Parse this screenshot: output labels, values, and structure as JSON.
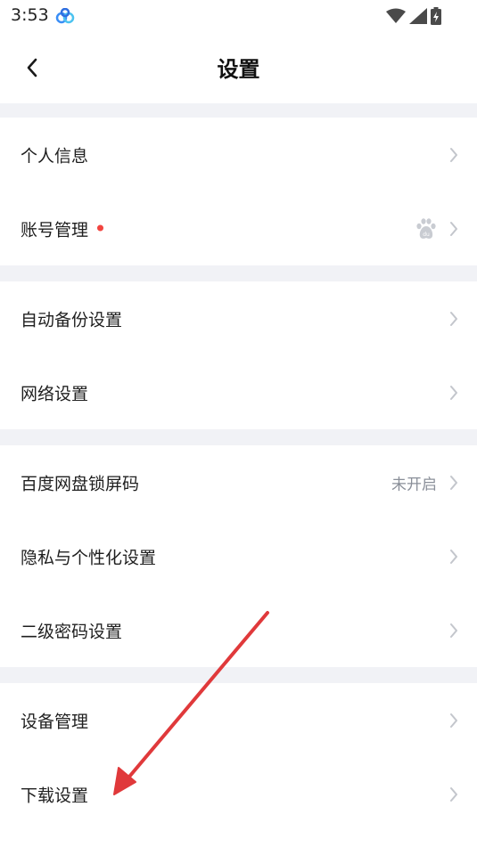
{
  "status_bar": {
    "time": "3:53",
    "app_icon": "baidu-netdisk-icon",
    "icons": [
      "wifi-icon",
      "signal-icon",
      "battery-charging-icon"
    ]
  },
  "header": {
    "title": "设置",
    "back_icon": "chevron-left-icon"
  },
  "groups": [
    {
      "items": [
        {
          "label": "个人信息",
          "value": ""
        },
        {
          "label": "账号管理",
          "value": "",
          "badge": "red-dot",
          "icon": "baidu-paw-icon"
        }
      ]
    },
    {
      "items": [
        {
          "label": "自动备份设置",
          "value": ""
        },
        {
          "label": "网络设置",
          "value": ""
        }
      ]
    },
    {
      "items": [
        {
          "label": "百度网盘锁屏码",
          "value": "未开启"
        },
        {
          "label": "隐私与个性化设置",
          "value": ""
        },
        {
          "label": "二级密码设置",
          "value": ""
        }
      ]
    },
    {
      "items": [
        {
          "label": "设备管理",
          "value": ""
        },
        {
          "label": "下载设置",
          "value": ""
        }
      ]
    }
  ],
  "colors": {
    "accent_red": "#f2443f",
    "divider_gray": "#f1f2f6",
    "annotation_arrow": "#e0393b"
  }
}
